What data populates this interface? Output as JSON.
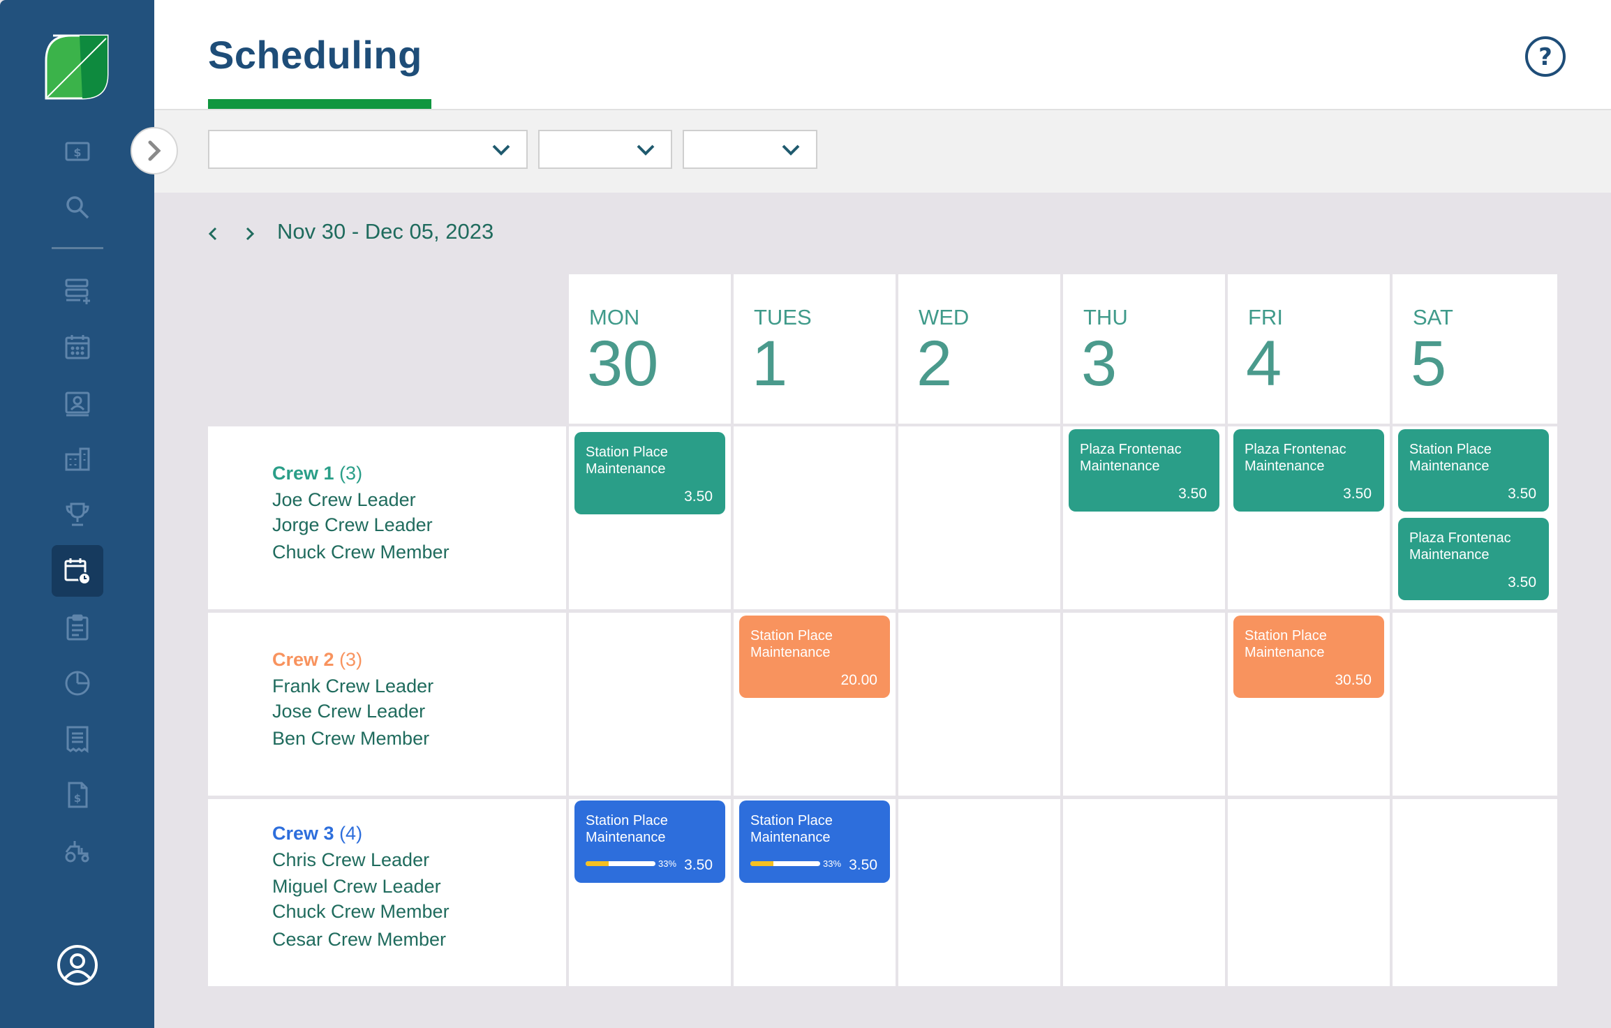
{
  "header": {
    "title": "Scheduling"
  },
  "filters": [
    {
      "value": ""
    },
    {
      "value": ""
    },
    {
      "value": ""
    }
  ],
  "date_nav": {
    "range": "Nov 30 - Dec 05, 2023"
  },
  "days": [
    {
      "dow": "MON",
      "date": "30"
    },
    {
      "dow": "TUES",
      "date": "1"
    },
    {
      "dow": "WED",
      "date": "2"
    },
    {
      "dow": "THU",
      "date": "3"
    },
    {
      "dow": "FRI",
      "date": "4"
    },
    {
      "dow": "SAT",
      "date": "5"
    }
  ],
  "colors": {
    "crew1": "#2a9e88",
    "crew2": "#f8935e",
    "crew3": "#2d6edc",
    "sidebar": "#22517d",
    "accent": "#10963f"
  },
  "crews": [
    {
      "name": "Crew 1",
      "count": "(3)",
      "members": [
        "Joe Crew Leader",
        "Jorge Crew Leader",
        "Chuck Crew Member"
      ]
    },
    {
      "name": "Crew 2",
      "count": "(3)",
      "members": [
        "Frank Crew Leader",
        "Jose Crew Leader",
        "Ben Crew Member"
      ]
    },
    {
      "name": "Crew 3",
      "count": "(4)",
      "members": [
        "Chris Crew Leader",
        "Miguel Crew Leader",
        "Chuck Crew Member",
        "Cesar Crew Member"
      ]
    }
  ],
  "jobs": {
    "c1_mon": {
      "name": "Station Place Maintenance",
      "hours": "3.50"
    },
    "c1_thu": {
      "name": "Plaza Frontenac Maintenance",
      "hours": "3.50"
    },
    "c1_fri": {
      "name": "Plaza Frontenac Maintenance",
      "hours": "3.50"
    },
    "c1_sat1": {
      "name": "Station Place Maintenance",
      "hours": "3.50"
    },
    "c1_sat2": {
      "name": "Plaza Frontenac Maintenance",
      "hours": "3.50"
    },
    "c2_tue": {
      "name": "Station Place Maintenance",
      "hours": "20.00"
    },
    "c2_fri": {
      "name": "Station Place Maintenance",
      "hours": "30.50"
    },
    "c3_mon": {
      "name": "Station Place Maintenance",
      "hours": "3.50",
      "progress_label": "33%",
      "progress": 0.33
    },
    "c3_tue": {
      "name": "Station Place Maintenance",
      "hours": "3.50",
      "progress_label": "33%",
      "progress": 0.33
    }
  },
  "icons": [
    "logo-icon",
    "dollar-icon",
    "search-icon",
    "add-list-icon",
    "calendar-icon",
    "contact-icon",
    "building-icon",
    "trophy-icon",
    "schedule-icon",
    "clipboard-icon",
    "pie-chart-icon",
    "receipt-icon",
    "invoice-icon",
    "tractor-icon",
    "profile-icon",
    "help-icon",
    "chevron-right-icon",
    "chevron-down-icon"
  ]
}
